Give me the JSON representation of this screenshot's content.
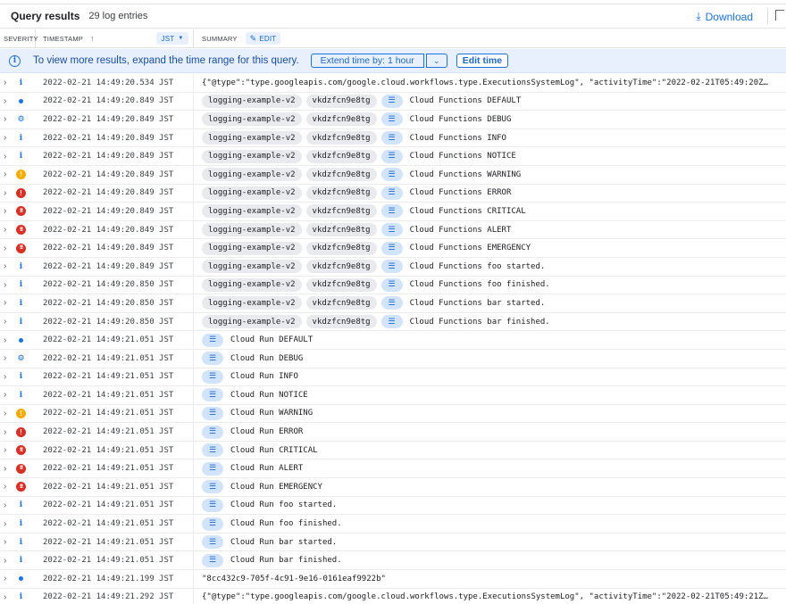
{
  "header": {
    "title": "Query results",
    "count": "29 log entries",
    "download_label": "Download"
  },
  "columns": {
    "severity": "SEVERITY",
    "timestamp": "TIMESTAMP",
    "timezone": "JST",
    "summary": "SUMMARY",
    "edit": "EDIT"
  },
  "banner": {
    "message": "To view more results, expand the time range for this query.",
    "extend_label": "Extend time by: 1 hour",
    "edit_time_label": "Edit time"
  },
  "rows": [
    {
      "severity": "info",
      "timestamp": "2022-02-21 14:49:20.534 JST",
      "text": "{\"@type\":\"type.googleapis.com/google.cloud.workflows.type.ExecutionsSystemLog\", \"activityTime\":\"2022-02-21T05:49:20Z…"
    },
    {
      "severity": "default",
      "timestamp": "2022-02-21 14:49:20.849 JST",
      "chips": [
        "logging-example-v2",
        "vkdzfcn9e8tg"
      ],
      "text": "Cloud Functions DEFAULT"
    },
    {
      "severity": "debug",
      "timestamp": "2022-02-21 14:49:20.849 JST",
      "chips": [
        "logging-example-v2",
        "vkdzfcn9e8tg"
      ],
      "text": "Cloud Functions DEBUG"
    },
    {
      "severity": "info",
      "timestamp": "2022-02-21 14:49:20.849 JST",
      "chips": [
        "logging-example-v2",
        "vkdzfcn9e8tg"
      ],
      "text": "Cloud Functions INFO"
    },
    {
      "severity": "info",
      "timestamp": "2022-02-21 14:49:20.849 JST",
      "chips": [
        "logging-example-v2",
        "vkdzfcn9e8tg"
      ],
      "text": "Cloud Functions NOTICE"
    },
    {
      "severity": "warning",
      "timestamp": "2022-02-21 14:49:20.849 JST",
      "chips": [
        "logging-example-v2",
        "vkdzfcn9e8tg"
      ],
      "text": "Cloud Functions WARNING"
    },
    {
      "severity": "error",
      "timestamp": "2022-02-21 14:49:20.849 JST",
      "chips": [
        "logging-example-v2",
        "vkdzfcn9e8tg"
      ],
      "text": "Cloud Functions ERROR"
    },
    {
      "severity": "critical",
      "timestamp": "2022-02-21 14:49:20.849 JST",
      "chips": [
        "logging-example-v2",
        "vkdzfcn9e8tg"
      ],
      "text": "Cloud Functions CRITICAL"
    },
    {
      "severity": "critical",
      "timestamp": "2022-02-21 14:49:20.849 JST",
      "chips": [
        "logging-example-v2",
        "vkdzfcn9e8tg"
      ],
      "text": "Cloud Functions ALERT"
    },
    {
      "severity": "critical",
      "timestamp": "2022-02-21 14:49:20.849 JST",
      "chips": [
        "logging-example-v2",
        "vkdzfcn9e8tg"
      ],
      "text": "Cloud Functions EMERGENCY"
    },
    {
      "severity": "info",
      "timestamp": "2022-02-21 14:49:20.849 JST",
      "chips": [
        "logging-example-v2",
        "vkdzfcn9e8tg"
      ],
      "text": "Cloud Functions foo started."
    },
    {
      "severity": "info",
      "timestamp": "2022-02-21 14:49:20.850 JST",
      "chips": [
        "logging-example-v2",
        "vkdzfcn9e8tg"
      ],
      "text": "Cloud Functions foo finished."
    },
    {
      "severity": "info",
      "timestamp": "2022-02-21 14:49:20.850 JST",
      "chips": [
        "logging-example-v2",
        "vkdzfcn9e8tg"
      ],
      "text": "Cloud Functions bar started."
    },
    {
      "severity": "info",
      "timestamp": "2022-02-21 14:49:20.850 JST",
      "chips": [
        "logging-example-v2",
        "vkdzfcn9e8tg"
      ],
      "text": "Cloud Functions bar finished."
    },
    {
      "severity": "default",
      "timestamp": "2022-02-21 14:49:21.051 JST",
      "chips": [],
      "text": "Cloud Run DEFAULT"
    },
    {
      "severity": "debug",
      "timestamp": "2022-02-21 14:49:21.051 JST",
      "chips": [],
      "text": "Cloud Run DEBUG"
    },
    {
      "severity": "info",
      "timestamp": "2022-02-21 14:49:21.051 JST",
      "chips": [],
      "text": "Cloud Run INFO"
    },
    {
      "severity": "info",
      "timestamp": "2022-02-21 14:49:21.051 JST",
      "chips": [],
      "text": "Cloud Run NOTICE"
    },
    {
      "severity": "warning",
      "timestamp": "2022-02-21 14:49:21.051 JST",
      "chips": [],
      "text": "Cloud Run WARNING"
    },
    {
      "severity": "error",
      "timestamp": "2022-02-21 14:49:21.051 JST",
      "chips": [],
      "text": "Cloud Run ERROR"
    },
    {
      "severity": "critical",
      "timestamp": "2022-02-21 14:49:21.051 JST",
      "chips": [],
      "text": "Cloud Run CRITICAL"
    },
    {
      "severity": "critical",
      "timestamp": "2022-02-21 14:49:21.051 JST",
      "chips": [],
      "text": "Cloud Run ALERT"
    },
    {
      "severity": "critical",
      "timestamp": "2022-02-21 14:49:21.051 JST",
      "chips": [],
      "text": "Cloud Run EMERGENCY"
    },
    {
      "severity": "info",
      "timestamp": "2022-02-21 14:49:21.051 JST",
      "chips": [],
      "text": "Cloud Run foo started."
    },
    {
      "severity": "info",
      "timestamp": "2022-02-21 14:49:21.051 JST",
      "chips": [],
      "text": "Cloud Run foo finished."
    },
    {
      "severity": "info",
      "timestamp": "2022-02-21 14:49:21.051 JST",
      "chips": [],
      "text": "Cloud Run bar started."
    },
    {
      "severity": "info",
      "timestamp": "2022-02-21 14:49:21.051 JST",
      "chips": [],
      "text": "Cloud Run bar finished."
    },
    {
      "severity": "default",
      "timestamp": "2022-02-21 14:49:21.199 JST",
      "text": "\"8cc432c9-705f-4c91-9e16-0161eaf9922b\""
    },
    {
      "severity": "info",
      "timestamp": "2022-02-21 14:49:21.292 JST",
      "text": "{\"@type\":\"type.googleapis.com/google.cloud.workflows.type.ExecutionsSystemLog\", \"activityTime\":\"2022-02-21T05:49:21Z…"
    }
  ],
  "colors": {
    "accent": "#1a73e8",
    "warning": "#f9ab00",
    "error": "#d93025",
    "banner_bg": "#e8f0fe"
  }
}
